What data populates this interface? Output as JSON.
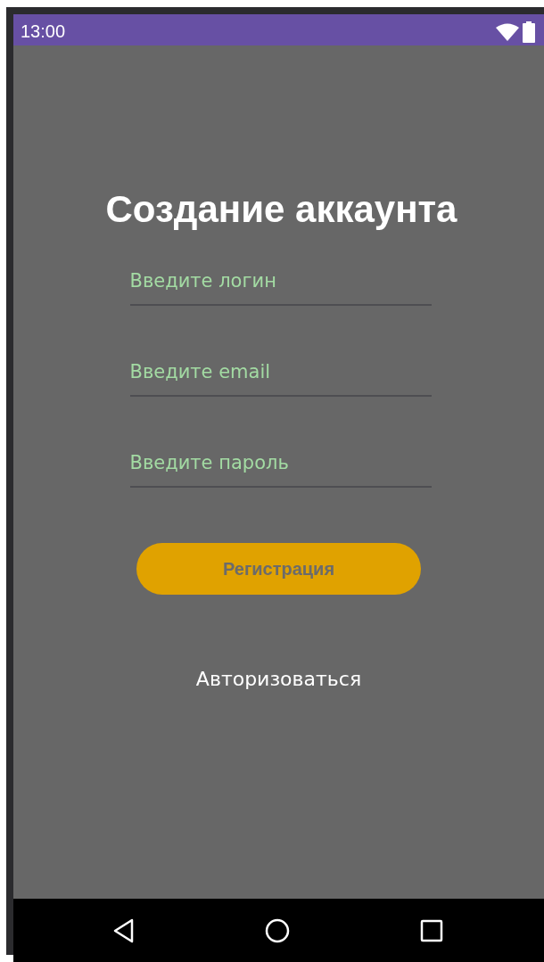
{
  "status_bar": {
    "time": "13:00"
  },
  "title": "Создание аккаунта",
  "fields": [
    {
      "placeholder": "Введите логин"
    },
    {
      "placeholder": "Введите email"
    },
    {
      "placeholder": "Введите пароль"
    }
  ],
  "register_button": "Регистрация",
  "login_link": "Авторизоваться"
}
